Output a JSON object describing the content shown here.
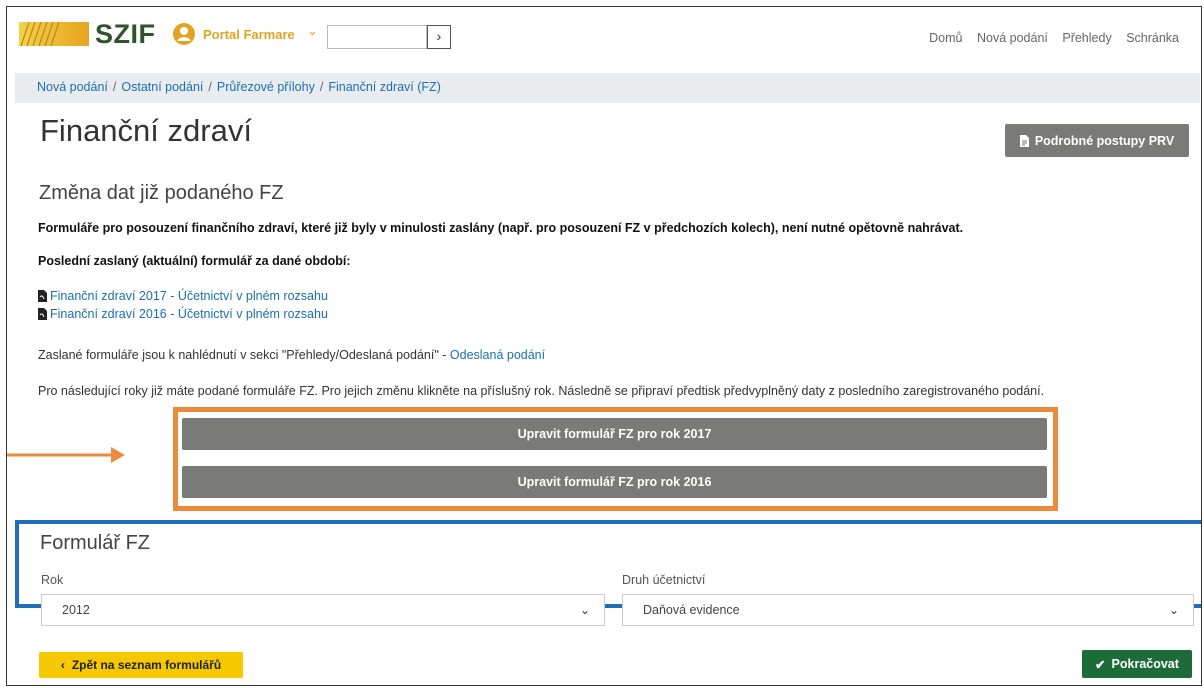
{
  "header": {
    "logo": "SZIF",
    "portal": "Portal Farmare",
    "nav": [
      "Domů",
      "Nová podání",
      "Přehledy",
      "Schránka"
    ]
  },
  "breadcrumb": [
    "Nová podání",
    "Ostatní podání",
    "Průřezové přílohy",
    "Finanční zdraví (FZ)"
  ],
  "page": {
    "title": "Finanční zdraví",
    "prv_button": "Podrobné postupy PRV",
    "section_title": "Změna dat již podaného FZ",
    "note_bold": "Formuláře pro posouzení finančního zdraví, které již byly v minulosti zaslány (např. pro posouzení FZ v předchozích kolech), není nutné opětovně nahrávat.",
    "last_sent_label": "Poslední zaslaný (aktuální) formulář za dané období:",
    "links": [
      "Finanční zdraví 2017 - Účetnictví v plném rozsahu",
      "Finanční zdraví 2016 - Účetnictví v plném rozsahu"
    ],
    "sent_info_text": "Zaslané formuláře jsou k nahlédnutí v sekci \"Přehledy/Odeslaná podání\" - ",
    "sent_info_link": "Odeslaná podání",
    "following_years_text": "Pro následující roky již máte podané formuláře FZ. Pro jejich změnu klikněte na příslušný rok. Následně se připraví předtisk předvyplněný daty z posledního zaregistrovaného podání.",
    "edit_buttons": [
      "Upravit formulář FZ pro rok 2017",
      "Upravit formulář FZ pro rok 2016"
    ]
  },
  "form": {
    "title": "Formulář FZ",
    "year_label": "Rok",
    "year_value": "2012",
    "accounting_label": "Druh účetnictví",
    "accounting_value": "Daňová evidence"
  },
  "actions": {
    "back": "Zpět na seznam formulářů",
    "next": "Pokračovat"
  },
  "colors": {
    "highlight_orange": "#ec8b3c",
    "highlight_blue": "#1e6fb8",
    "brand_green": "#2b5629",
    "accent_yellow": "#f5c800",
    "continue_green": "#1e6b3a"
  }
}
